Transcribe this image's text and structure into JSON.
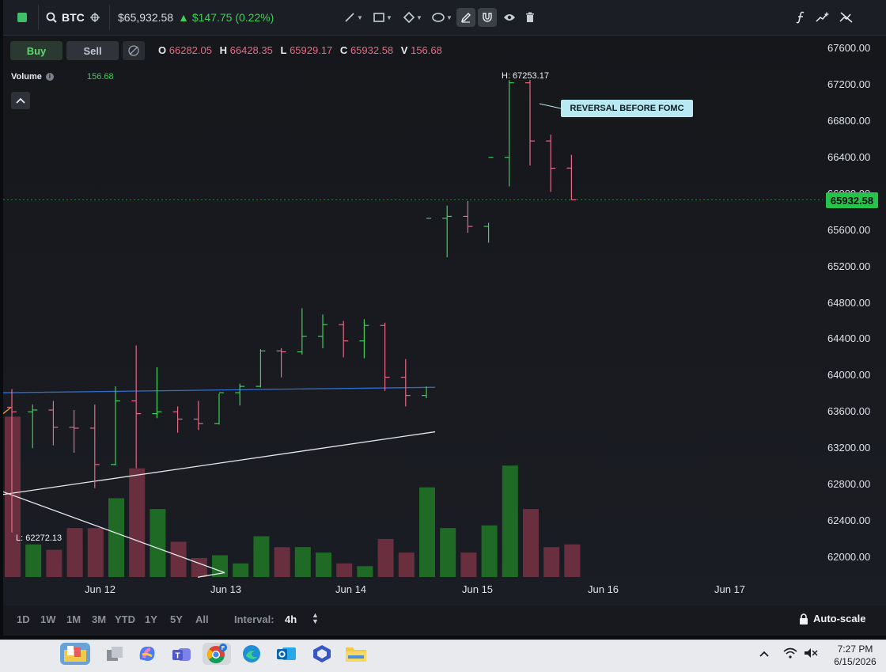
{
  "toolbar": {
    "symbol": "BTC",
    "price": "$65,932.58",
    "change": "$147.75 (0.22%)",
    "change_arrow": "▲",
    "icons": [
      "status-square-icon",
      "search-icon",
      "crosshair-icon",
      "line-tool-icon",
      "rectangle-tool-icon",
      "shape-tool-icon",
      "comment-tool-icon",
      "pen-icon",
      "magnet-icon",
      "eye-icon",
      "trash-icon",
      "function-icon",
      "compare-icon",
      "hide-indicators-icon"
    ]
  },
  "trade": {
    "buy_label": "Buy",
    "sell_label": "Sell"
  },
  "ohlc": {
    "o_label": "O",
    "o": "66282.05",
    "h_label": "H",
    "h": "66428.35",
    "l_label": "L",
    "l": "65929.17",
    "c_label": "C",
    "c": "65932.58",
    "v_label": "V",
    "v": "156.68"
  },
  "volume": {
    "label": "Volume",
    "value": "156.68"
  },
  "colors": {
    "up": "#3fcf5a",
    "down": "#e56a84",
    "up_vol": "#1f6a24",
    "down_vol": "#6a2f3e",
    "last_price": "#27c24c",
    "trendline": "#2f6fd0"
  },
  "chart_data": {
    "type": "ohlc",
    "interval": "4h",
    "y_ticks": [
      "67600.00",
      "67200.00",
      "66800.00",
      "66400.00",
      "66000.00",
      "65600.00",
      "65200.00",
      "64800.00",
      "64400.00",
      "64000.00",
      "63600.00",
      "63200.00",
      "62800.00",
      "62400.00",
      "62000.00"
    ],
    "x_ticks": [
      "Jun 12",
      "Jun 13",
      "Jun 14",
      "Jun 15",
      "Jun 16",
      "Jun 17"
    ],
    "last_price": "65932.58",
    "high_annotation": "H: 67253.17",
    "low_annotation": "L: 62272.13",
    "callout": "REVERSAL BEFORE FOMC",
    "bars": [
      {
        "o": 63650,
        "h": 63850,
        "l": 62272,
        "c": 63600,
        "v": 59
      },
      {
        "o": 63600,
        "h": 63680,
        "l": 63200,
        "c": 63620,
        "v": 12
      },
      {
        "o": 63620,
        "h": 63720,
        "l": 63230,
        "c": 63430,
        "v": 10
      },
      {
        "o": 63430,
        "h": 63620,
        "l": 63150,
        "c": 63420,
        "v": 18
      },
      {
        "o": 63420,
        "h": 63680,
        "l": 62760,
        "c": 63020,
        "v": 18
      },
      {
        "o": 63020,
        "h": 63880,
        "l": 63010,
        "c": 63720,
        "v": 29
      },
      {
        "o": 63720,
        "h": 64330,
        "l": 62980,
        "c": 63580,
        "v": 40
      },
      {
        "o": 63580,
        "h": 64090,
        "l": 63530,
        "c": 63600,
        "v": 25
      },
      {
        "o": 63600,
        "h": 63660,
        "l": 63370,
        "c": 63520,
        "v": 13
      },
      {
        "o": 63520,
        "h": 63720,
        "l": 63400,
        "c": 63470,
        "v": 7
      },
      {
        "o": 63470,
        "h": 63800,
        "l": 63460,
        "c": 63810,
        "v": 8
      },
      {
        "o": 63810,
        "h": 63910,
        "l": 63670,
        "c": 63880,
        "v": 5
      },
      {
        "o": 63880,
        "h": 64290,
        "l": 63870,
        "c": 64270,
        "v": 15
      },
      {
        "o": 64270,
        "h": 64300,
        "l": 63980,
        "c": 64260,
        "v": 11
      },
      {
        "o": 64260,
        "h": 64740,
        "l": 64230,
        "c": 64430,
        "v": 11
      },
      {
        "o": 64430,
        "h": 64670,
        "l": 64300,
        "c": 64560,
        "v": 9
      },
      {
        "o": 64560,
        "h": 64600,
        "l": 64200,
        "c": 64380,
        "v": 5
      },
      {
        "o": 64380,
        "h": 64620,
        "l": 64190,
        "c": 64550,
        "v": 4
      },
      {
        "o": 64550,
        "h": 64580,
        "l": 63830,
        "c": 63980,
        "v": 14
      },
      {
        "o": 63980,
        "h": 64180,
        "l": 63660,
        "c": 63780,
        "v": 9
      },
      {
        "o": 63780,
        "h": 63880,
        "l": 63750,
        "c": 65730,
        "v": 33
      },
      {
        "o": 65730,
        "h": 65870,
        "l": 65300,
        "c": 65750,
        "v": 18
      },
      {
        "o": 65750,
        "h": 65920,
        "l": 65570,
        "c": 65640,
        "v": 9
      },
      {
        "o": 65640,
        "h": 65680,
        "l": 65460,
        "c": 66400,
        "v": 19
      },
      {
        "o": 66400,
        "h": 67250,
        "l": 66080,
        "c": 67220,
        "v": 41
      },
      {
        "o": 67220,
        "h": 67253,
        "l": 66310,
        "c": 66580,
        "v": 25
      },
      {
        "o": 66580,
        "h": 66650,
        "l": 66020,
        "c": 66280,
        "v": 11
      },
      {
        "o": 66282.05,
        "h": 66428.35,
        "l": 65929.17,
        "c": 65932.58,
        "v": 12
      }
    ]
  },
  "ranges": [
    "1D",
    "1W",
    "1M",
    "3M",
    "YTD",
    "1Y",
    "5Y",
    "All"
  ],
  "interval": {
    "label": "Interval:",
    "value": "4h"
  },
  "autoscale": "Auto-scale",
  "taskbar": {
    "apps": [
      "file-explorer-icon",
      "start-icon",
      "copilot-icon",
      "teams-icon",
      "chrome-icon",
      "edge-icon",
      "outlook-icon",
      "store-icon",
      "folder-icon"
    ],
    "chrome_badge": "F",
    "time": "7:27 PM",
    "date": "6/15/2026"
  }
}
